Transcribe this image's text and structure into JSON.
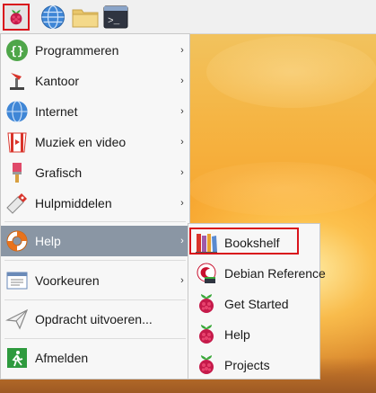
{
  "colors": {
    "highlight_red": "#d9141c",
    "active_row": "#8a96a4",
    "menu_bg": "#f7f7f7",
    "panel_bg": "#f0f0f0"
  },
  "panel": {
    "buttons": [
      {
        "name": "raspberry-menu-icon",
        "selected": true
      },
      {
        "name": "web-browser-icon"
      },
      {
        "name": "file-manager-icon"
      },
      {
        "name": "terminal-icon",
        "text": ">_"
      }
    ]
  },
  "menu": {
    "items": [
      {
        "label": "Programmeren",
        "icon": "programming-icon",
        "submenu": true
      },
      {
        "label": "Kantoor",
        "icon": "office-icon",
        "submenu": true
      },
      {
        "label": "Internet",
        "icon": "internet-globe-icon",
        "submenu": true
      },
      {
        "label": "Muziek en video",
        "icon": "music-video-icon",
        "submenu": true
      },
      {
        "label": "Grafisch",
        "icon": "graphics-icon",
        "submenu": true
      },
      {
        "label": "Hulpmiddelen",
        "icon": "accessories-icon",
        "submenu": true
      },
      {
        "label": "Help",
        "icon": "help-lifebuoy-icon",
        "submenu": true,
        "active": true
      },
      {
        "label": "Voorkeuren",
        "icon": "preferences-icon",
        "submenu": true
      },
      {
        "label": "Opdracht uitvoeren...",
        "icon": "run-command-icon",
        "submenu": false
      },
      {
        "label": "Afmelden",
        "icon": "logout-icon",
        "submenu": false
      }
    ],
    "arrow": "›"
  },
  "help_submenu": {
    "items": [
      {
        "label": "Bookshelf",
        "icon": "bookshelf-icon",
        "highlighted": true
      },
      {
        "label": "Debian Reference",
        "icon": "debian-icon"
      },
      {
        "label": "Get Started",
        "icon": "raspberry-icon"
      },
      {
        "label": "Help",
        "icon": "raspberry-icon"
      },
      {
        "label": "Projects",
        "icon": "raspberry-icon"
      }
    ]
  }
}
